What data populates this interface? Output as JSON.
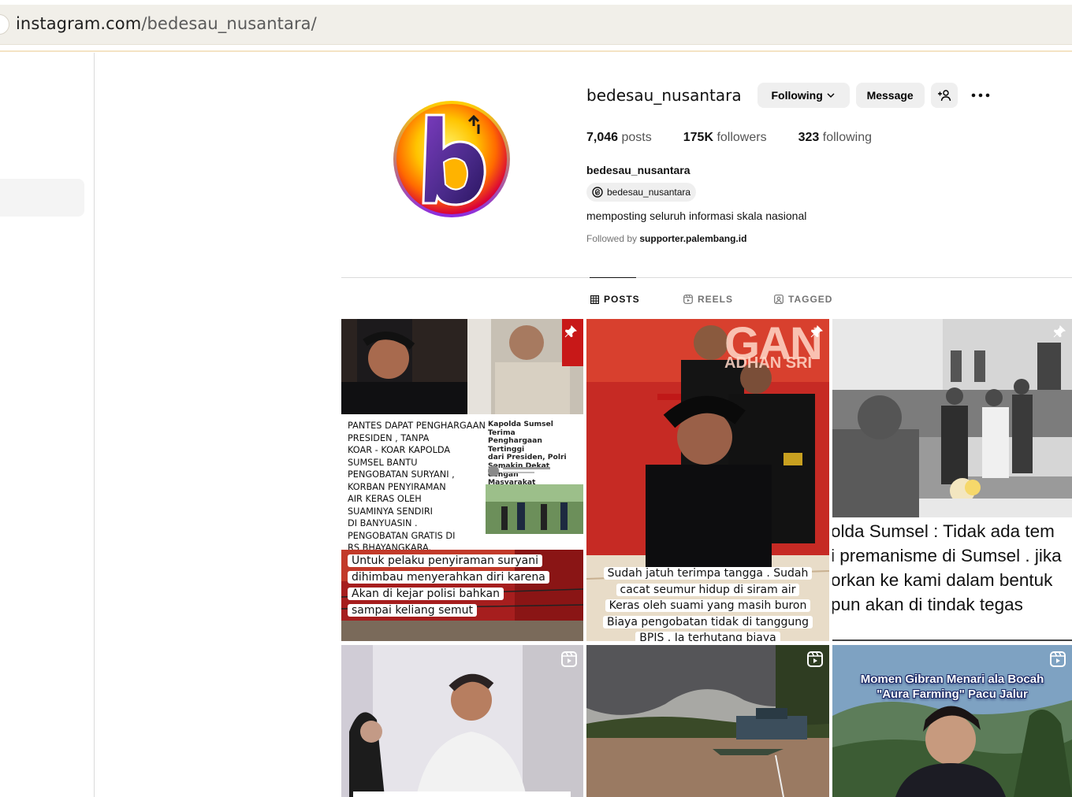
{
  "browser": {
    "url_host": "instagram.com",
    "url_path": "/bedesau_nusantara/"
  },
  "profile": {
    "username": "bedesau_nusantara",
    "following_label": "Following",
    "message_label": "Message",
    "add_user_icon": "add-user-icon",
    "more_icon": "more-icon",
    "posts_count": "7,046",
    "posts_label": "posts",
    "followers_count": "175K",
    "followers_label": "followers",
    "following_count": "323",
    "following_stat_label": "following",
    "full_name": "bedesau_nusantara",
    "threads_handle": "bedesau_nusantara",
    "bio": "memposting seluruh informasi skala nasional",
    "followed_by_prefix": "Followed by",
    "followed_by_user": "supporter.palembang.id"
  },
  "tabs": [
    {
      "label": "POSTS",
      "icon": "grid-icon",
      "active": true
    },
    {
      "label": "REELS",
      "icon": "reels-icon",
      "active": false
    },
    {
      "label": "TAGGED",
      "icon": "tagged-icon",
      "active": false
    }
  ],
  "posts": {
    "p1": {
      "headline_left": [
        "PANTES DAPAT PENGHARGAAN",
        "PRESIDEN , TANPA",
        "KOAR - KOAR KAPOLDA",
        "SUMSEL BANTU",
        "PENGOBATAN SURYANI ,",
        "KORBAN PENYIRAMAN",
        "AIR KERAS OLEH",
        "SUAMINYA SENDIRI",
        "DI BANYUASIN .",
        "PENGOBATAN GRATIS DI",
        "RS BHAYANGKARA."
      ],
      "headline_right": [
        "Kapolda Sumsel Terima",
        "Penghargaan Tertinggi",
        "dari Presiden, Polri",
        "Semakin Dekat dengan",
        "Masyarakat"
      ],
      "caption": [
        "Untuk pelaku penyiraman suryani",
        "dihimbau menyerahkan diri karena",
        "Akan di kejar polisi bahkan",
        "sampai keliang semut"
      ]
    },
    "p2": {
      "banner": "GAN",
      "banner_sub": "ADHAN SRI",
      "caption": [
        "Sudah jatuh terimpa tangga . Sudah",
        "cacat seumur hidup di siram air",
        "Keras oleh suami yang masih buron",
        "Biaya pengobatan tidak di tanggung",
        "BPJS . Ia terhutang biaya"
      ]
    },
    "p3": {
      "caption": [
        "olda Sumsel :  Tidak ada tem",
        "i premanisme di Sumsel . jika",
        "orkan ke kami dalam bentuk",
        "pun akan di tindak tegas"
      ]
    },
    "p6": {
      "title": [
        "Momen Gibran Menari ala Bocah",
        "\"Aura Farming\" Pacu Jalur"
      ]
    }
  },
  "colors": {
    "accent_gray": "#efefef",
    "divider": "#dbdbdb",
    "muted": "#737373"
  }
}
